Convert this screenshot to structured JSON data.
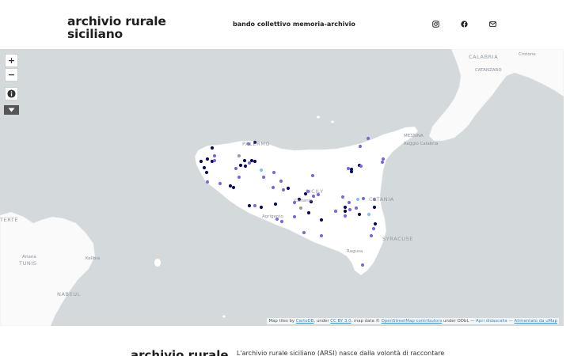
{
  "header": {
    "title": "archivio rurale siciliano",
    "nav_link": "bando collettivo memoria-archivio",
    "social": [
      "instagram-icon",
      "facebook-icon",
      "email-icon"
    ]
  },
  "map": {
    "controls": {
      "zoom_in": "+",
      "zoom_out": "−"
    },
    "labels": {
      "calabria": "CALABRIA",
      "crotone": "Crotone",
      "catanzaro": "CATANZARO",
      "messina": "MESSINA",
      "reggio": "Reggio Calabria",
      "palermo": "PALERMO",
      "sicily": "SICILY",
      "catania": "CATANIA",
      "syracuse": "SYRACUSE",
      "ragusa": "Ragusa",
      "agrigento": "Agrigento",
      "caltanissetta": "Caltanis",
      "tunis": "TUNIS",
      "ariana": "Ariana",
      "kelibia": "Kelibia",
      "nabeul": "NABEUL",
      "terte": "TERTE"
    },
    "attribution": {
      "prefix": "Map tiles by",
      "cartodb": "CartoDB",
      "under": ", under",
      "license": "CC BY 3.0",
      "data": ". map data ©",
      "osm": "OpenStreetMap contributors",
      "odbl": "under ODbL —",
      "caption": "Apri didascalia",
      "dash": "—",
      "umap": "Alimentato da uMap"
    },
    "marker_colors": {
      "navy": "#0b0b5c",
      "violet": "#7b6bd6",
      "sky": "#7cc7ef",
      "grey": "#9a9aa6"
    }
  },
  "footer": {
    "title": "archivio rurale",
    "intro": "L'archivio rurale siciliano (ARSI) nasce dalla volontà di raccontare"
  }
}
